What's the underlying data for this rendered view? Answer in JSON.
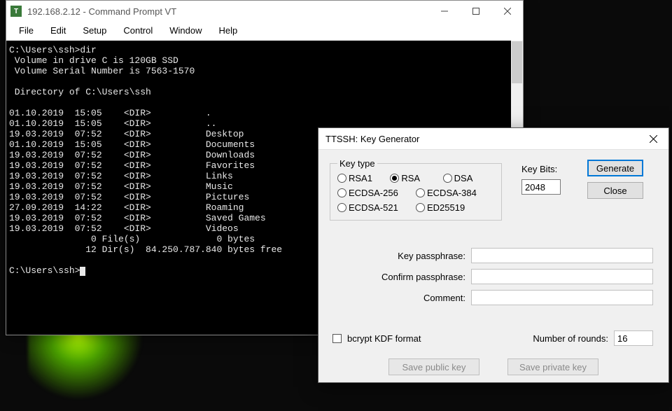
{
  "terminal": {
    "title": "192.168.2.12 - Command Prompt VT",
    "menu": [
      "File",
      "Edit",
      "Setup",
      "Control",
      "Window",
      "Help"
    ],
    "lines": [
      "C:\\Users\\ssh>dir",
      " Volume in drive C is 120GB SSD",
      " Volume Serial Number is 7563-1570",
      "",
      " Directory of C:\\Users\\ssh",
      "",
      "01.10.2019  15:05    <DIR>          .",
      "01.10.2019  15:05    <DIR>          ..",
      "19.03.2019  07:52    <DIR>          Desktop",
      "01.10.2019  15:05    <DIR>          Documents",
      "19.03.2019  07:52    <DIR>          Downloads",
      "19.03.2019  07:52    <DIR>          Favorites",
      "19.03.2019  07:52    <DIR>          Links",
      "19.03.2019  07:52    <DIR>          Music",
      "19.03.2019  07:52    <DIR>          Pictures",
      "27.09.2019  14:22    <DIR>          Roaming",
      "19.03.2019  07:52    <DIR>          Saved Games",
      "19.03.2019  07:52    <DIR>          Videos",
      "               0 File(s)              0 bytes",
      "              12 Dir(s)  84.250.787.840 bytes free",
      "",
      "C:\\Users\\ssh>"
    ]
  },
  "dialog": {
    "title": "TTSSH: Key Generator",
    "keytype_legend": "Key type",
    "radios": {
      "rsa1": "RSA1",
      "rsa": "RSA",
      "dsa": "DSA",
      "ecdsa256": "ECDSA-256",
      "ecdsa384": "ECDSA-384",
      "ecdsa521": "ECDSA-521",
      "ed25519": "ED25519"
    },
    "selected_radio": "rsa",
    "keybits_label": "Key Bits:",
    "keybits_value": "2048",
    "buttons": {
      "generate": "Generate",
      "close": "Close",
      "save_pub": "Save public key",
      "save_priv": "Save private key"
    },
    "labels": {
      "passphrase": "Key passphrase:",
      "confirm": "Confirm passphrase:",
      "comment": "Comment:",
      "bcrypt": "bcrypt KDF format",
      "rounds": "Number of rounds:"
    },
    "fields": {
      "passphrase": "",
      "confirm": "",
      "comment": "",
      "rounds": "16"
    }
  }
}
